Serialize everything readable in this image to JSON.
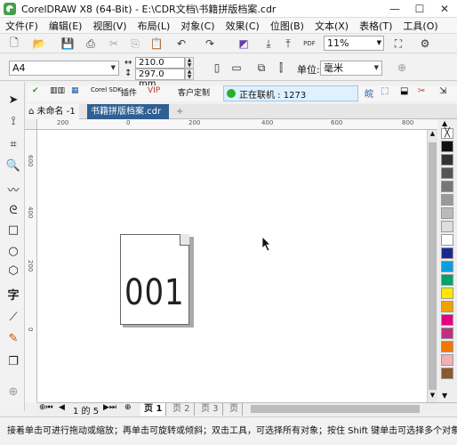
{
  "window": {
    "title": "CorelDRAW X8 (64-Bit) - E:\\CDR文档\\书籍拼版档案.cdr",
    "minimize_icon": "minimize-icon",
    "maximize_icon": "maximize-icon",
    "close_icon": "close-icon"
  },
  "menu": {
    "items": [
      "文件(F)",
      "编辑(E)",
      "视图(V)",
      "布局(L)",
      "对象(C)",
      "效果(C)",
      "位图(B)",
      "文本(X)",
      "表格(T)",
      "工具(O)"
    ],
    "right": [
      "—",
      "□",
      "×"
    ]
  },
  "toolbar": {
    "zoom": "11%",
    "pdf_label": "PDF"
  },
  "property_bar": {
    "page_size": "A4",
    "width": "210.0 mm",
    "height": "297.0 mm",
    "units_label": "单位:",
    "units_value": "毫米"
  },
  "plugin_bar": {
    "items": [
      "Corel SDK",
      "插件",
      "VIP",
      "客户定制"
    ],
    "online_status": "正在联机 : 1273"
  },
  "tabs": {
    "home_label": "未命名 -1",
    "doc_label": "书籍拼版档案.cdr",
    "add_label": "+"
  },
  "rulers": {
    "top_labels": [
      "200",
      "0",
      "200",
      "400",
      "600",
      "800"
    ],
    "left_labels": [
      "600",
      "400",
      "200",
      "0"
    ]
  },
  "document": {
    "page_number": "001"
  },
  "palette": {
    "colors": [
      "#111111",
      "#333333",
      "#555555",
      "#777777",
      "#999999",
      "#bbbbbb",
      "#dddddd",
      "#ffffff",
      "#1a2a8c",
      "#0aa0e0",
      "#00a36b",
      "#ffe600",
      "#f2a000",
      "#e6007e",
      "#c03080",
      "#f07800",
      "#f2b0b0",
      "#8a5a2a"
    ]
  },
  "page_nav": {
    "page_count": "1 的 5",
    "tabs": [
      "页 1",
      "页 2",
      "页 3",
      "页"
    ]
  },
  "status": {
    "text": "接着单击可进行拖动或缩放；再单击可旋转或倾斜；双击工具，可选择所有对象；按住 Shift 键单击可选择多个对象"
  }
}
